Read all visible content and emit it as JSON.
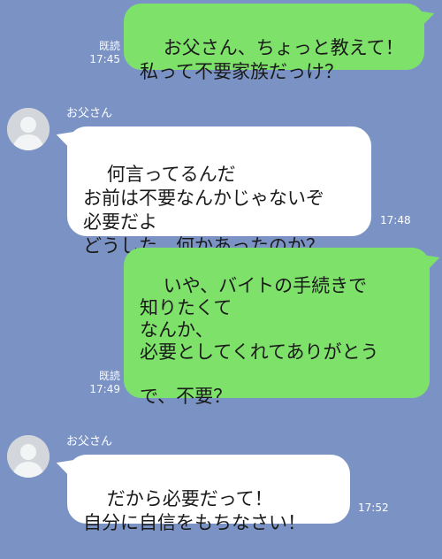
{
  "messages": {
    "m1": {
      "lines": "お父さん、ちょっと教えて！\n私って不要家族だっけ？",
      "read": "既読",
      "time": "17:45"
    },
    "m2": {
      "sender": "お父さん",
      "lines": "何言ってるんだ\nお前は不要なんかじゃないぞ\n必要だよ\nどうした、何かあったのか？",
      "time": "17:48",
      "avatar_icon": "default-person-icon"
    },
    "m3": {
      "lines": "いや、バイトの手続きで\n知りたくて\nなんか、\n必要としてくれてありがとう\n\nで、不要？",
      "read": "既読",
      "time": "17:49"
    },
    "m4": {
      "sender": "お父さん",
      "lines": "だから必要だって！\n自分に自信をもちなさい！",
      "time": "17:52",
      "avatar_icon": "default-person-icon"
    }
  },
  "colors": {
    "background": "#7b93c4",
    "outgoing_bubble": "#7ee26a",
    "incoming_bubble": "#ffffff",
    "avatar_bg": "#d3d6db"
  }
}
